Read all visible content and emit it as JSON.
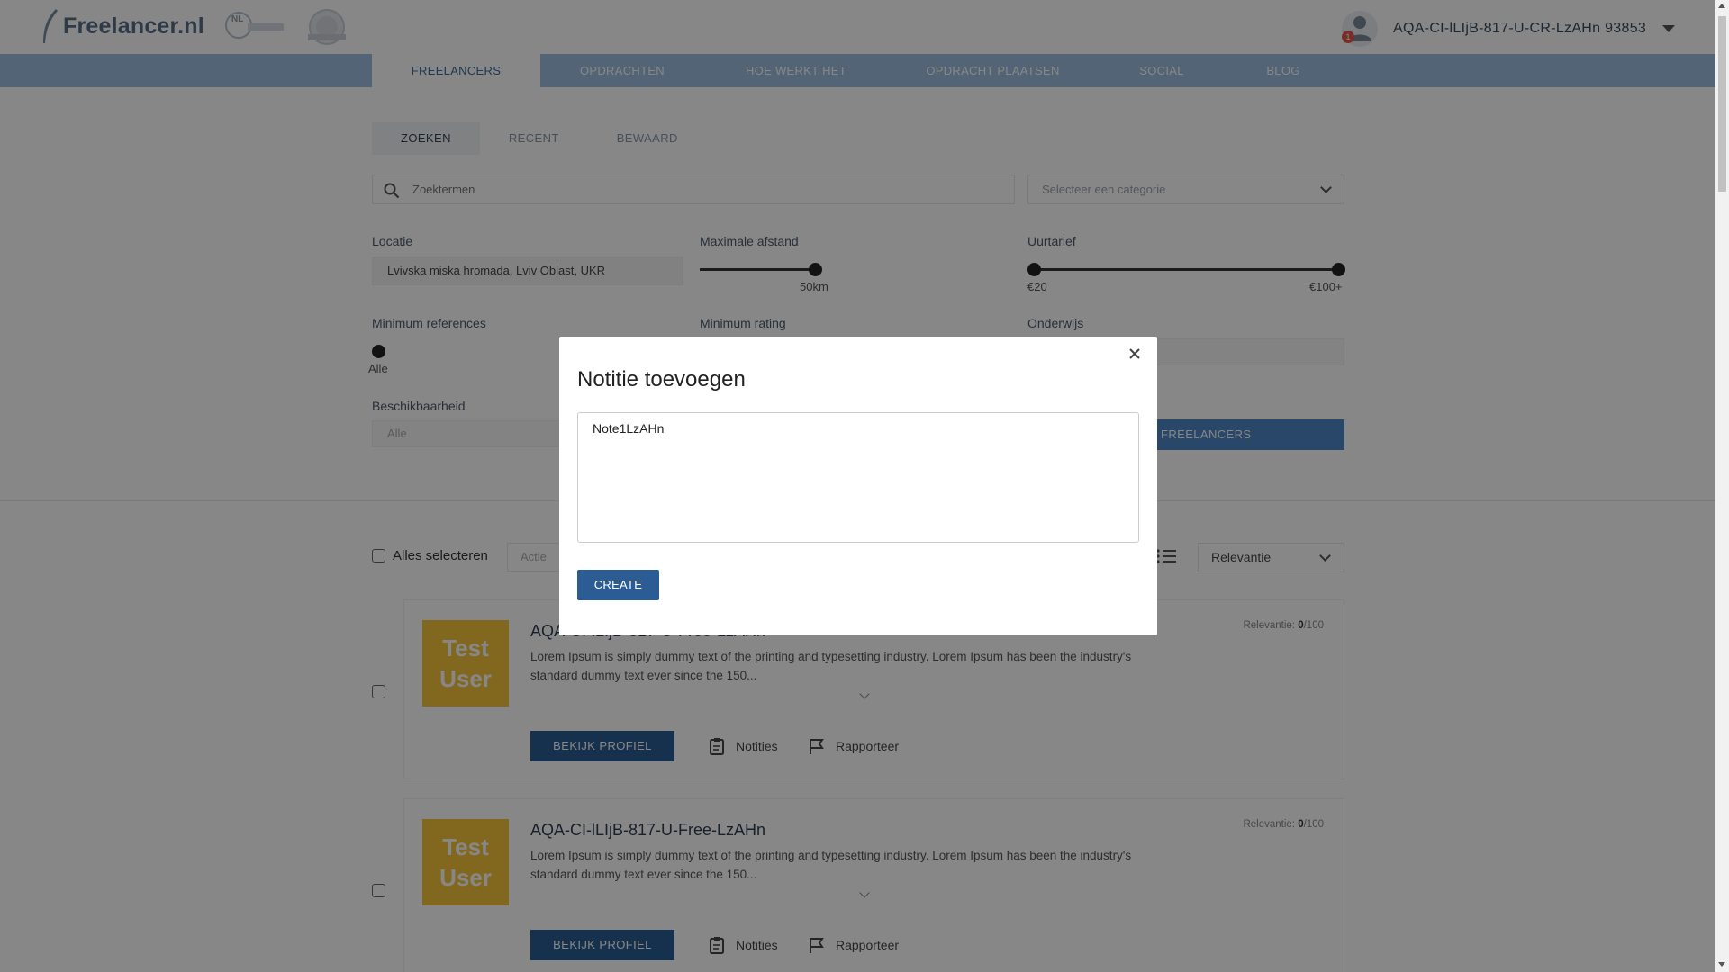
{
  "header": {
    "logo_text": "Freelancer.nl",
    "badge_text": "NL",
    "user_name": "AQA-CI-lLIjB-817-U-CR-LzAHn 93853",
    "notification_count": "1"
  },
  "nav": {
    "items": [
      "FREELANCERS",
      "OPDRACHTEN",
      "HOE WERKT HET",
      "OPDRACHT PLAATSEN",
      "SOCIAL",
      "BLOG"
    ],
    "active": "FREELANCERS"
  },
  "subtabs": [
    "ZOEKEN",
    "RECENT",
    "BEWAARD"
  ],
  "search": {
    "placeholder": "Zoektermen",
    "category_placeholder": "Selecteer een categorie"
  },
  "filters": {
    "location_label": "Locatie",
    "location_value": "Lvivska miska hromada, Lviv Oblast, UKR",
    "distance_label": "Maximale afstand",
    "distance_value": "50km",
    "rate_label": "Uurtarief",
    "rate_min": "€20",
    "rate_max": "€100+",
    "references_label": "Minimum references",
    "references_value": "Alle",
    "rating_label": "Minimum rating",
    "education_label": "Onderwijs",
    "availability_label": "Beschikbaarheid",
    "availability_value": "Alle",
    "search_button": "FREELANCERS"
  },
  "results": {
    "select_all": "Alles selecteren",
    "action_placeholder": "Actie",
    "sort_value": "Relevantie",
    "cards": [
      {
        "title": "AQA-CI-lLIjB-817-U-Free-LzAHn",
        "avatar_text": "Test User",
        "description": "Lorem Ipsum is simply dummy text of the printing and typesetting industry. Lorem Ipsum has been the industry's standard dummy text ever since the 150...",
        "relevance_label": "Relevantie:",
        "relevance_score": "0",
        "relevance_max": "/100",
        "profile_button": "BEKIJK PROFIEL",
        "notes_label": "Notities",
        "report_label": "Rapporteer"
      },
      {
        "title": "AQA-CI-lLIjB-817-U-Free-LzAHn",
        "avatar_text": "Test User",
        "description": "Lorem Ipsum is simply dummy text of the printing and typesetting industry. Lorem Ipsum has been the industry's standard dummy text ever since the 150...",
        "relevance_label": "Relevantie:",
        "relevance_score": "0",
        "relevance_max": "/100",
        "profile_button": "BEKIJK PROFIEL",
        "notes_label": "Notities",
        "report_label": "Rapporteer"
      }
    ]
  },
  "modal": {
    "title": "Notitie toevoegen",
    "textarea_value": "Note1LzAHn",
    "submit_label": "CREATE"
  },
  "colors": {
    "nav_bg": "#9bbdde",
    "primary_button": "#2b5d94",
    "avatar_bg": "#f6c43c",
    "overlay": "rgba(0,0,0,0.47)"
  }
}
